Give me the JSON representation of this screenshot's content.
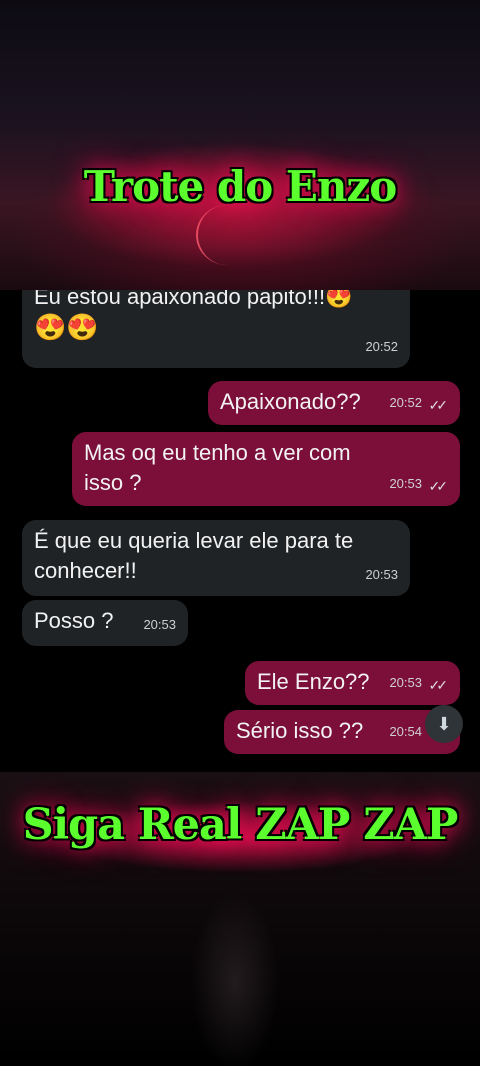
{
  "banners": {
    "top_title": "Trote do Enzo",
    "bottom_title": "Siga Real ZAP ZAP"
  },
  "messages": [
    {
      "side": "in",
      "text_line1": "Eu estou apaixonado papito!!!😍",
      "text_line2": "😍😍",
      "time": "20:52"
    },
    {
      "side": "out",
      "text": "Apaixonado??",
      "time": "20:52",
      "ticks": "✓✓"
    },
    {
      "side": "out",
      "text_line1": "Mas oq eu tenho a ver com",
      "text_line2": "isso ?",
      "time": "20:53",
      "ticks": "✓✓"
    },
    {
      "side": "in",
      "text_line1": "É que eu queria levar ele para te",
      "text_line2": "conhecer!!",
      "time": "20:53"
    },
    {
      "side": "in",
      "text": "Posso ?",
      "time": "20:53"
    },
    {
      "side": "out",
      "text": "Ele Enzo??",
      "time": "20:53",
      "ticks": "✓✓"
    },
    {
      "side": "out",
      "text": "Sério isso ??",
      "time": "20:54",
      "ticks": "✓✓"
    }
  ],
  "scroll_button_icon": "double-chevron-down-icon",
  "colors": {
    "incoming": "#1f2326",
    "outgoing": "#7b0f3a",
    "title_green": "#5cff2e",
    "glow": "#ff0a5a"
  }
}
